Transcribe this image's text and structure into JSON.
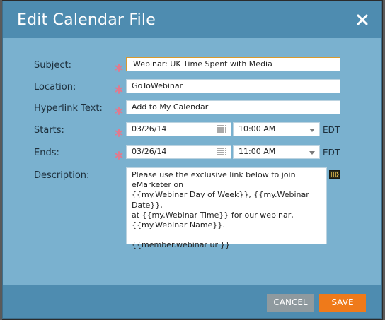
{
  "dialog": {
    "title": "Edit Calendar File"
  },
  "form": {
    "subject": {
      "label": "Subject:",
      "value": "Webinar: UK Time Spent with Media"
    },
    "location": {
      "label": "Location:",
      "value": "GoToWebinar"
    },
    "hyperlink": {
      "label": "Hyperlink Text:",
      "value": "Add to My Calendar"
    },
    "starts": {
      "label": "Starts:",
      "date": "03/26/14",
      "time": "10:00 AM",
      "tz": "EDT"
    },
    "ends": {
      "label": "Ends:",
      "date": "03/26/14",
      "time": "11:00 AM",
      "tz": "EDT"
    },
    "description": {
      "label": "Description:",
      "value": "Please use the exclusive link below to join eMarketer on\n{{my.Webinar Day of Week}}, {{my.Webinar Date}},\nat {{my.Webinar Time}} for our webinar,\n{{my.Webinar Name}}.\n\n{{member.webinar url}}"
    }
  },
  "footer": {
    "cancel_label": "CANCEL",
    "save_label": "SAVE"
  },
  "colors": {
    "titlebar": "#4e8cb0",
    "body": "#7ab1cf",
    "required_star": "#e07a8f",
    "save": "#ef7a1a",
    "cancel": "#8f9a9f"
  },
  "icons": {
    "close": "close-icon",
    "required": "asterisk-icon",
    "calendar": "calendar-icon",
    "dropdown": "chevron-down-icon",
    "tokens": "token-insert-icon"
  }
}
